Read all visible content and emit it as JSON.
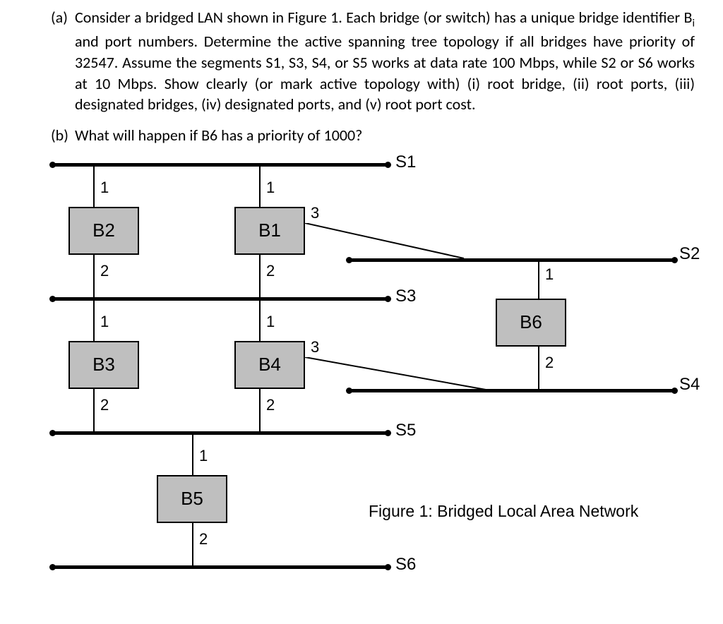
{
  "parts": {
    "a": {
      "label": "(a)",
      "text": "Consider a bridged LAN shown in Figure 1. Each bridge (or switch) has a unique bridge identifier B<sub>i</sub> and port numbers. Determine the active spanning tree topology if all bridges have priority of 32547. Assume the segments S1, S3, S4, or S5 works at data rate 100 Mbps, while S2 or S6 works at 10 Mbps. Show clearly (or mark active topology with) (i) root bridge, (ii) root ports, (iii) designated bridges, (iv) designated ports, and (v) root port cost."
    },
    "b": {
      "label": "(b)",
      "text": "What will happen if B6 has a priority of 1000?"
    }
  },
  "segments": {
    "S1": "S1",
    "S2": "S2",
    "S3": "S3",
    "S4": "S4",
    "S5": "S5",
    "S6": "S6"
  },
  "bridges": {
    "B1": "B1",
    "B2": "B2",
    "B3": "B3",
    "B4": "B4",
    "B5": "B5",
    "B6": "B6"
  },
  "ports": {
    "p1": "1",
    "p2": "2",
    "p3": "3"
  },
  "caption": "Figure 1: Bridged Local Area Network",
  "chart_data": {
    "type": "diagram",
    "title": "Figure 1: Bridged Local Area Network",
    "bridge_priority_default": 32547,
    "segments": [
      {
        "id": "S1",
        "rate_mbps": 100
      },
      {
        "id": "S2",
        "rate_mbps": 10
      },
      {
        "id": "S3",
        "rate_mbps": 100
      },
      {
        "id": "S4",
        "rate_mbps": 100
      },
      {
        "id": "S5",
        "rate_mbps": 100
      },
      {
        "id": "S6",
        "rate_mbps": 10
      }
    ],
    "bridges": [
      {
        "id": "B1",
        "ports": [
          {
            "num": 1,
            "segment": "S1"
          },
          {
            "num": 2,
            "segment": "S3"
          },
          {
            "num": 3,
            "segment": "S2"
          }
        ]
      },
      {
        "id": "B2",
        "ports": [
          {
            "num": 1,
            "segment": "S1"
          },
          {
            "num": 2,
            "segment": "S3"
          }
        ]
      },
      {
        "id": "B3",
        "ports": [
          {
            "num": 1,
            "segment": "S3"
          },
          {
            "num": 2,
            "segment": "S5"
          }
        ]
      },
      {
        "id": "B4",
        "ports": [
          {
            "num": 1,
            "segment": "S3"
          },
          {
            "num": 2,
            "segment": "S5"
          },
          {
            "num": 3,
            "segment": "S4"
          }
        ]
      },
      {
        "id": "B5",
        "ports": [
          {
            "num": 1,
            "segment": "S5"
          },
          {
            "num": 2,
            "segment": "S6"
          }
        ]
      },
      {
        "id": "B6",
        "ports": [
          {
            "num": 1,
            "segment": "S2"
          },
          {
            "num": 2,
            "segment": "S4"
          }
        ]
      }
    ]
  }
}
